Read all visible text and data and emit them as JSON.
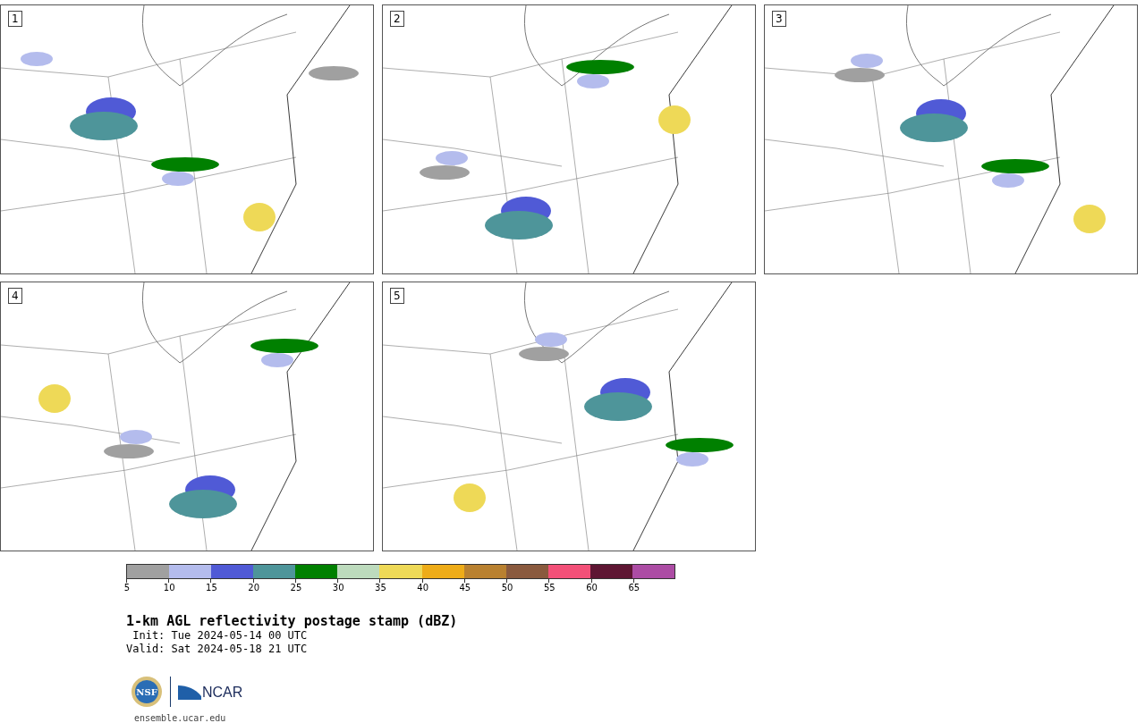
{
  "panels": [
    {
      "label": "1"
    },
    {
      "label": "2"
    },
    {
      "label": "3"
    },
    {
      "label": "4"
    },
    {
      "label": "5"
    }
  ],
  "colorbar": {
    "segments": [
      {
        "color": "#a0a0a0"
      },
      {
        "color": "#b4bced"
      },
      {
        "color": "#505ad6"
      },
      {
        "color": "#4e959a"
      },
      {
        "color": "#008000"
      },
      {
        "color": "#bddbbd"
      },
      {
        "color": "#eed957"
      },
      {
        "color": "#eeac18"
      },
      {
        "color": "#b98130"
      },
      {
        "color": "#8a5a3e"
      },
      {
        "color": "#f35078"
      },
      {
        "color": "#5e1633"
      },
      {
        "color": "#ac4ca4"
      }
    ],
    "ticks": [
      "5",
      "10",
      "15",
      "20",
      "25",
      "30",
      "35",
      "40",
      "45",
      "50",
      "55",
      "60",
      "65"
    ]
  },
  "title": "1-km AGL reflectivity postage stamp (dBZ)",
  "init": "Init: Tue 2024-05-14 00 UTC",
  "valid": "Valid: Sat 2024-05-18 21 UTC",
  "logos": {
    "nsf": "NSF",
    "ncar": "NCAR"
  },
  "url": "ensemble.ucar.edu"
}
